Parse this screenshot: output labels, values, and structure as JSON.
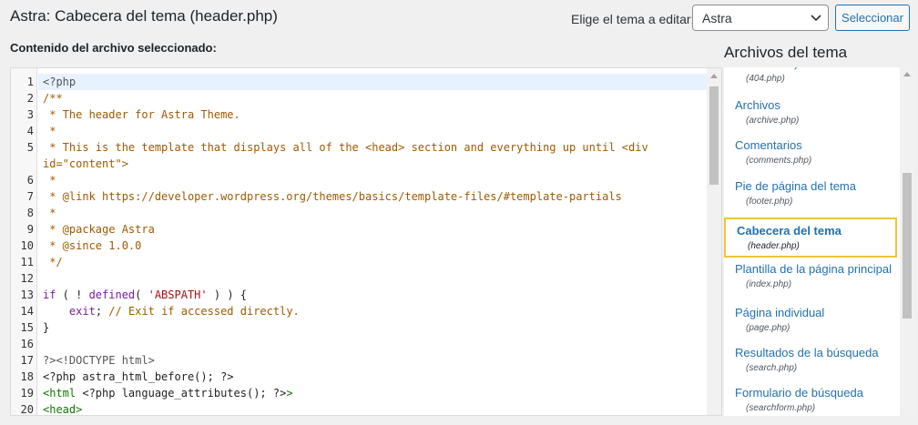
{
  "header": {
    "title": "Astra: Cabecera del tema (header.php)",
    "choose_label": "Elige el tema a editar:",
    "theme_select_value": "Astra",
    "select_button": "Seleccionar"
  },
  "editor": {
    "label": "Contenido del archivo seleccionado:",
    "lines": [
      {
        "n": "1",
        "text": "<?php",
        "cls": "c-meta"
      },
      {
        "n": "2",
        "text": "/**",
        "cls": "c-comment"
      },
      {
        "n": "3",
        "text": " * The header for Astra Theme.",
        "cls": "c-comment"
      },
      {
        "n": "4",
        "text": " *",
        "cls": "c-comment"
      },
      {
        "n": "5",
        "text": " * This is the template that displays all of the <head> section and everything up until <div",
        "cls": "c-comment"
      },
      {
        "n": "",
        "text": "id=\"content\">",
        "cls": "c-comment"
      },
      {
        "n": "6",
        "text": " *",
        "cls": "c-comment"
      },
      {
        "n": "7",
        "text": " * @link https://developer.wordpress.org/themes/basics/template-files/#template-partials",
        "cls": "c-comment"
      },
      {
        "n": "8",
        "text": " *",
        "cls": "c-comment"
      },
      {
        "n": "9",
        "text": " * @package Astra",
        "cls": "c-comment"
      },
      {
        "n": "10",
        "text": " * @since 1.0.0",
        "cls": "c-comment"
      },
      {
        "n": "11",
        "text": " */",
        "cls": "c-comment"
      },
      {
        "n": "12",
        "text": "",
        "cls": "c-plain"
      },
      {
        "n": "13",
        "text": "",
        "cls": "c-plain",
        "parts": [
          {
            "t": "if",
            "c": "c-kw"
          },
          {
            "t": " ( ! ",
            "c": "c-plain"
          },
          {
            "t": "defined",
            "c": "c-kw"
          },
          {
            "t": "( ",
            "c": "c-plain"
          },
          {
            "t": "'ABSPATH'",
            "c": "c-str"
          },
          {
            "t": " ) ) {",
            "c": "c-plain"
          }
        ]
      },
      {
        "n": "14",
        "text": "",
        "cls": "c-plain",
        "parts": [
          {
            "t": "    ",
            "c": "c-plain"
          },
          {
            "t": "exit",
            "c": "c-kw"
          },
          {
            "t": "; ",
            "c": "c-plain"
          },
          {
            "t": "// Exit if accessed directly.",
            "c": "c-comment"
          }
        ]
      },
      {
        "n": "15",
        "text": "}",
        "cls": "c-plain"
      },
      {
        "n": "16",
        "text": "",
        "cls": "c-plain"
      },
      {
        "n": "17",
        "text": "?><!DOCTYPE html>",
        "cls": "c-meta"
      },
      {
        "n": "18",
        "text": "<?php astra_html_before(); ?>",
        "cls": "c-plain"
      },
      {
        "n": "19",
        "text": "",
        "cls": "c-plain",
        "parts": [
          {
            "t": "<html",
            "c": "c-green"
          },
          {
            "t": " <?php language_attributes(); ?>",
            "c": "c-plain"
          },
          {
            "t": ">",
            "c": "c-green"
          }
        ]
      },
      {
        "n": "20",
        "text": "<head>",
        "cls": "c-green"
      }
    ]
  },
  "files": {
    "title": "Archivos del tema",
    "items": [
      {
        "name": "encontrada)",
        "file": "(404.php)",
        "selected": false
      },
      {
        "name": "Archivos",
        "file": "(archive.php)",
        "selected": false
      },
      {
        "name": "Comentarios",
        "file": "(comments.php)",
        "selected": false
      },
      {
        "name": "Pie de página del tema",
        "file": "(footer.php)",
        "selected": false
      },
      {
        "name": "Cabecera del tema",
        "file": "(header.php)",
        "selected": true
      },
      {
        "name": "Plantilla de la página principal",
        "file": "(index.php)",
        "selected": false
      },
      {
        "name": "Página individual",
        "file": "(page.php)",
        "selected": false
      },
      {
        "name": "Resultados de la búsqueda",
        "file": "(search.php)",
        "selected": false
      },
      {
        "name": "Formulario de búsqueda",
        "file": "(searchform.php)",
        "selected": false
      }
    ]
  }
}
